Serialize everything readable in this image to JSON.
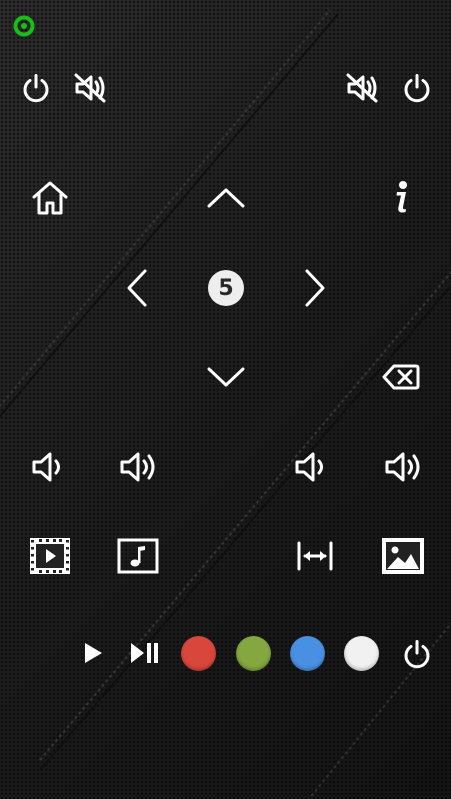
{
  "status": {
    "indicator_color": "#16c016"
  },
  "icons": {
    "power_top_left": "power-icon",
    "mute_top_left": "mute-icon",
    "mute_top_right": "mute-icon",
    "power_top_right": "power-icon",
    "home": "home-icon",
    "info": "info-icon",
    "up": "chevron-up-icon",
    "down": "chevron-down-icon",
    "left": "chevron-left-icon",
    "right": "chevron-right-icon",
    "backspace": "backspace-icon",
    "video": "film-icon",
    "music": "music-note-icon",
    "aspect": "aspect-ratio-icon",
    "photo": "image-icon",
    "play": "play-icon",
    "play_pause": "play-pause-icon",
    "power_bottom": "power-icon"
  },
  "dpad": {
    "center_label": "5"
  },
  "color_buttons": [
    {
      "name": "red",
      "color": "#d9473c"
    },
    {
      "name": "green",
      "color": "#84a73f"
    },
    {
      "name": "blue",
      "color": "#4a90e2"
    },
    {
      "name": "white",
      "color": "#f1f1f1"
    }
  ]
}
